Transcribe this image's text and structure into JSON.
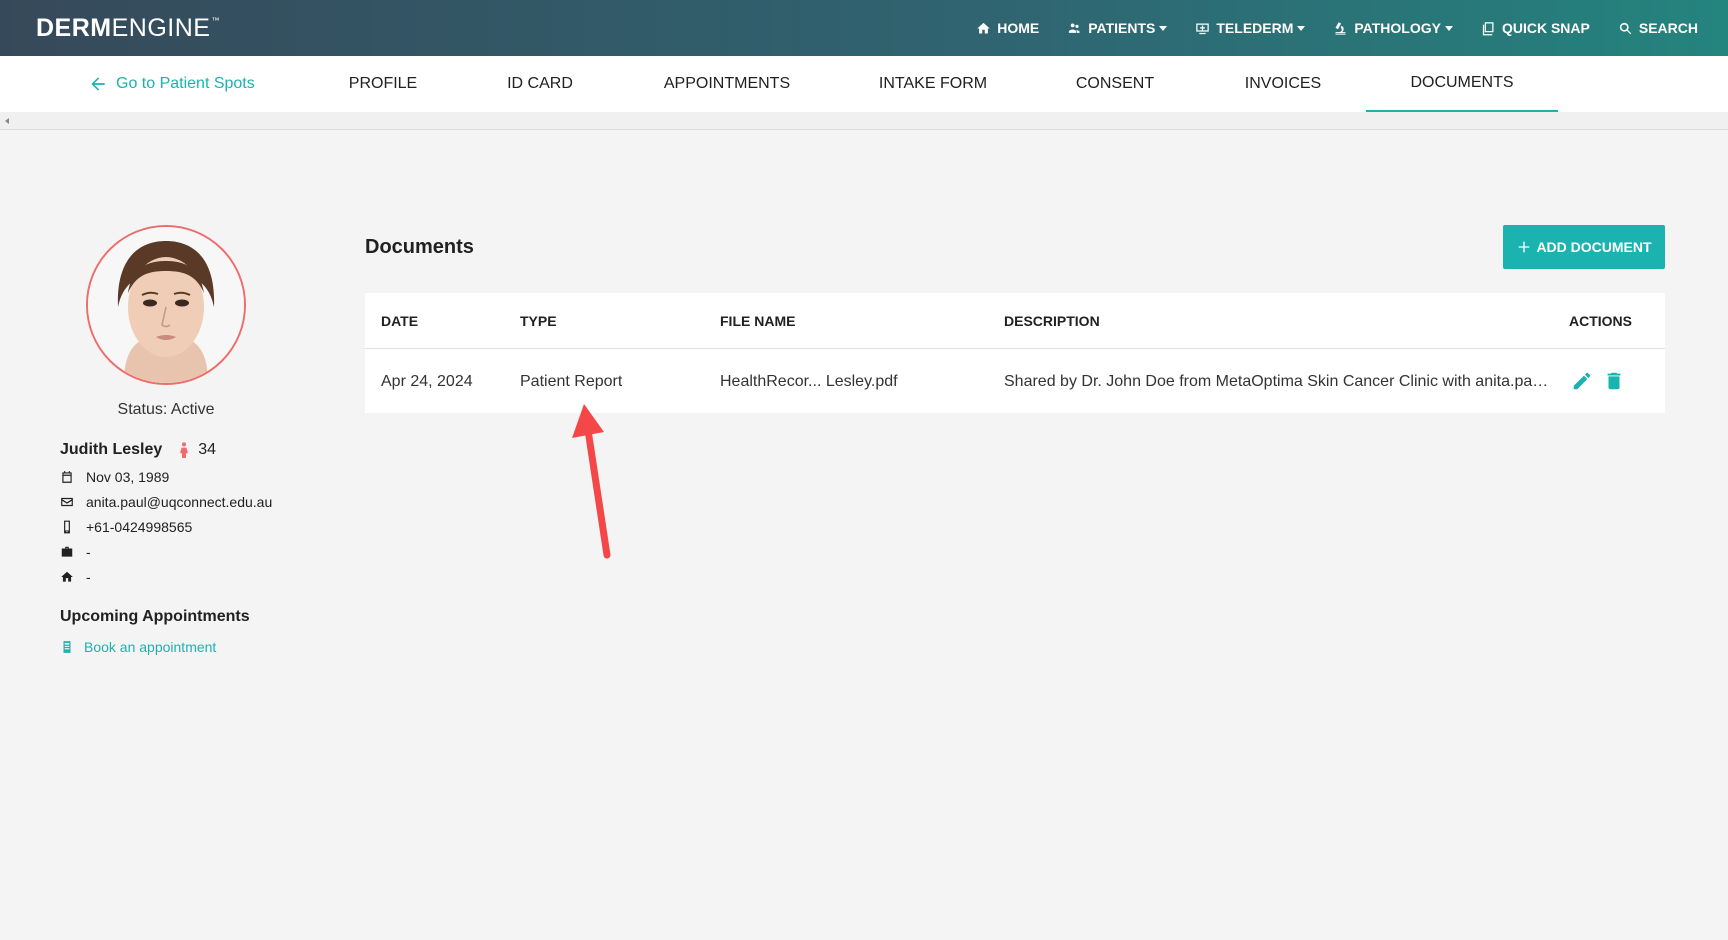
{
  "brand": {
    "bold": "DERM",
    "light": "ENGINE",
    "tm": "™"
  },
  "nav": {
    "home": "HOME",
    "patients": "PATIENTS",
    "telederm": "TELEDERM",
    "pathology": "PATHOLOGY",
    "quick_snap": "QUICK SNAP",
    "search": "SEARCH"
  },
  "tabs": {
    "back": "Go to Patient Spots",
    "items": [
      "PROFILE",
      "ID CARD",
      "APPOINTMENTS",
      "INTAKE FORM",
      "CONSENT",
      "INVOICES",
      "DOCUMENTS"
    ],
    "active": "DOCUMENTS"
  },
  "patient": {
    "status": "Status: Active",
    "name": "Judith Lesley",
    "age": "34",
    "dob": "Nov 03, 1989",
    "email": "anita.paul@uqconnect.edu.au",
    "phone": "+61-0424998565",
    "work": "-",
    "address": "-"
  },
  "upcoming": {
    "title": "Upcoming Appointments",
    "book": "Book an appointment"
  },
  "documents": {
    "title": "Documents",
    "add_button": "ADD DOCUMENT",
    "columns": {
      "date": "DATE",
      "type": "TYPE",
      "file_name": "FILE NAME",
      "description": "DESCRIPTION",
      "actions": "ACTIONS"
    },
    "rows": [
      {
        "date": "Apr 24, 2024",
        "type": "Patient Report",
        "file_name": "HealthRecor... Lesley.pdf",
        "description": "Shared by Dr. John Doe from MetaOptima Skin Cancer Clinic with anita.paul@uqconnect.edu.au"
      }
    ]
  },
  "colors": {
    "accent": "#1ab3b0",
    "annotation": "#f44848",
    "avatar_ring": "#ef6c6c"
  }
}
